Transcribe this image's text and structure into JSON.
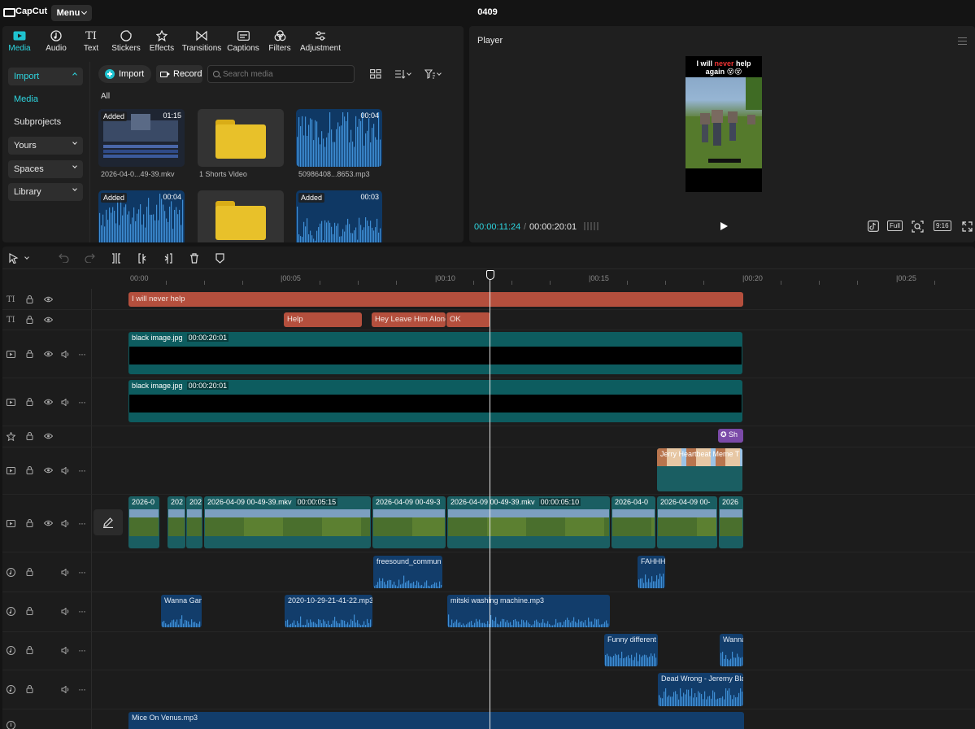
{
  "app": {
    "brand": "CapCut",
    "menu_label": "Menu",
    "project_name": "0409"
  },
  "media_tabs": [
    {
      "label": "Media",
      "icon": "media-icon"
    },
    {
      "label": "Audio",
      "icon": "audio-icon"
    },
    {
      "label": "Text",
      "icon": "text-icon"
    },
    {
      "label": "Stickers",
      "icon": "stickers-icon"
    },
    {
      "label": "Effects",
      "icon": "effects-icon"
    },
    {
      "label": "Transitions",
      "icon": "transitions-icon"
    },
    {
      "label": "Captions",
      "icon": "captions-icon"
    },
    {
      "label": "Filters",
      "icon": "filters-icon"
    },
    {
      "label": "Adjustment",
      "icon": "adjustment-icon"
    }
  ],
  "sidebar": {
    "import": "Import",
    "media": "Media",
    "subprojects": "Subprojects",
    "yours": "Yours",
    "spaces": "Spaces",
    "library": "Library"
  },
  "media_toolbar": {
    "import": "Import",
    "record": "Record",
    "search_placeholder": "Search media",
    "filter_all": "All"
  },
  "media_items": [
    {
      "name": "2026-04-0...49-39.mkv",
      "badge": "Added",
      "duration": "01:15",
      "type": "video"
    },
    {
      "name": "1 Shorts Video",
      "badge": "",
      "duration": "",
      "type": "folder"
    },
    {
      "name": "50986408...8653.mp3",
      "badge": "",
      "duration": "00:04",
      "type": "audio"
    },
    {
      "name": "",
      "badge": "Added",
      "duration": "00:04",
      "type": "audio"
    },
    {
      "name": "",
      "badge": "",
      "duration": "",
      "type": "folder"
    },
    {
      "name": "",
      "badge": "Added",
      "duration": "00:03",
      "type": "audio"
    }
  ],
  "player": {
    "title": "Player",
    "caption_a": "I will ",
    "caption_red": "never",
    "caption_b": " help",
    "caption_line2": "again 😵😵",
    "current_time": "00:00:11:24",
    "separator": "/",
    "total_time": "00:00:20:01",
    "full_label": "Full",
    "ratio_label": "9:16"
  },
  "timeline": {
    "ruler": [
      "00:00",
      "|00:05",
      "|00:10",
      "|00:15",
      "|00:20",
      "|00:25"
    ],
    "text_track_1": [
      "I will never help"
    ],
    "text_track_2": [
      "Help",
      "Hey Leave Him Alone",
      "OK"
    ],
    "video_track_1": {
      "name": "black image.jpg",
      "duration": "00:00:20:01"
    },
    "video_track_2": {
      "name": "black image.jpg",
      "duration": "00:00:20:01"
    },
    "effect_track": {
      "name": "Sh"
    },
    "overlay_track": {
      "name": "Jerry Heartbeat Meme T"
    },
    "main_track": [
      {
        "name": "2026-0",
        "duration": ""
      },
      {
        "name": "202",
        "duration": ""
      },
      {
        "name": "202",
        "duration": ""
      },
      {
        "name": "2026-04-09 00-49-39.mkv",
        "duration": "00:00:05:15"
      },
      {
        "name": "2026-04-09 00-49-3",
        "duration": ""
      },
      {
        "name": "2026-04-09 00-49-39.mkv",
        "duration": "00:00:05:10"
      },
      {
        "name": "2026-04-0",
        "duration": ""
      },
      {
        "name": "2026-04-09 00-",
        "duration": ""
      },
      {
        "name": "2026",
        "duration": ""
      }
    ],
    "audio_track_1": [
      "freesound_commun",
      "FAHHH."
    ],
    "audio_track_2": [
      "Wanna Gam",
      "2020-10-29-21-41-22.mp3",
      "mitski washing machine.mp3"
    ],
    "audio_track_3": [
      "Funny different",
      "Wanna"
    ],
    "audio_track_4": [
      "Dead Wrong - Jeremy Bla"
    ],
    "audio_track_5": [
      "Mice On Venus.mp3"
    ]
  },
  "colors": {
    "accent": "#2ed6e0",
    "text_clip": "#b44f3d",
    "video_clip": "#0d5c5f",
    "audio_clip": "#123d6b",
    "effect_clip": "#7b4aa8"
  }
}
